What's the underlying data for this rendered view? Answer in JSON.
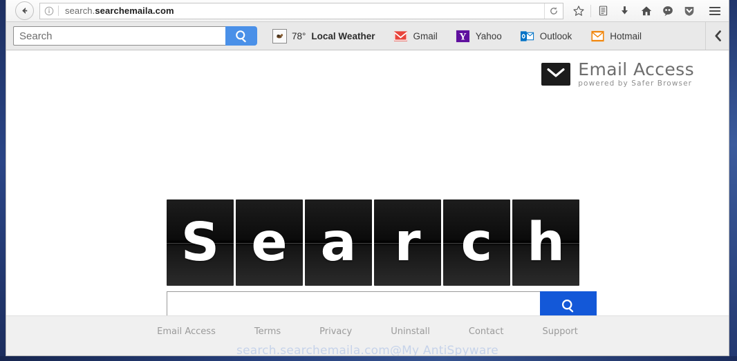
{
  "browser": {
    "url_prefix": "search.",
    "url_domain": "searchemaila.com",
    "back_icon": "back-arrow-icon",
    "identity_icon": "info-icon",
    "reload_icon": "reload-icon",
    "toolbar_icons": [
      {
        "name": "bookmark-star-icon",
        "label": "Bookmark"
      },
      {
        "name": "library-icon",
        "label": "Library"
      },
      {
        "name": "download-icon",
        "label": "Downloads"
      },
      {
        "name": "home-icon",
        "label": "Home"
      },
      {
        "name": "chat-icon",
        "label": "Chat"
      },
      {
        "name": "pocket-shield-icon",
        "label": "Pocket"
      }
    ],
    "menu_icon": "hamburger-menu-icon"
  },
  "ext_toolbar": {
    "search_placeholder": "Search",
    "search_value": "",
    "search_button_icon": "search-icon",
    "weather": {
      "temperature": "78°",
      "label": "Local Weather",
      "icon": "weather-icon"
    },
    "links": [
      {
        "label": "Gmail",
        "icon": "gmail-icon"
      },
      {
        "label": "Yahoo",
        "icon": "yahoo-icon"
      },
      {
        "label": "Outlook",
        "icon": "outlook-icon"
      },
      {
        "label": "Hotmail",
        "icon": "hotmail-icon"
      }
    ],
    "overflow_icon": "chevron-left-icon"
  },
  "page": {
    "brand": {
      "title": "Email Access",
      "subtitle": "powered by Safer Browser",
      "icon": "envelope-icon"
    },
    "flipboard": {
      "letters": [
        "S",
        "e",
        "a",
        "r",
        "c",
        "h"
      ]
    },
    "main_search": {
      "value": "",
      "placeholder": "",
      "button_icon": "search-icon"
    },
    "footer_links": [
      "Email Access",
      "Terms",
      "Privacy",
      "Uninstall",
      "Contact",
      "Support"
    ],
    "watermark": "search.searchemaila.com@My AntiSpyware"
  },
  "colors": {
    "ext_search_button": "#4a90e8",
    "main_search_button": "#1358d8",
    "gmail_red": "#e8453c",
    "yahoo_purple": "#5f0f9e",
    "outlook_blue": "#0072c6",
    "hotmail_orange": "#f2870d",
    "desktop_blue": "#2a4486",
    "watermark_blue": "#c6d3ea"
  }
}
